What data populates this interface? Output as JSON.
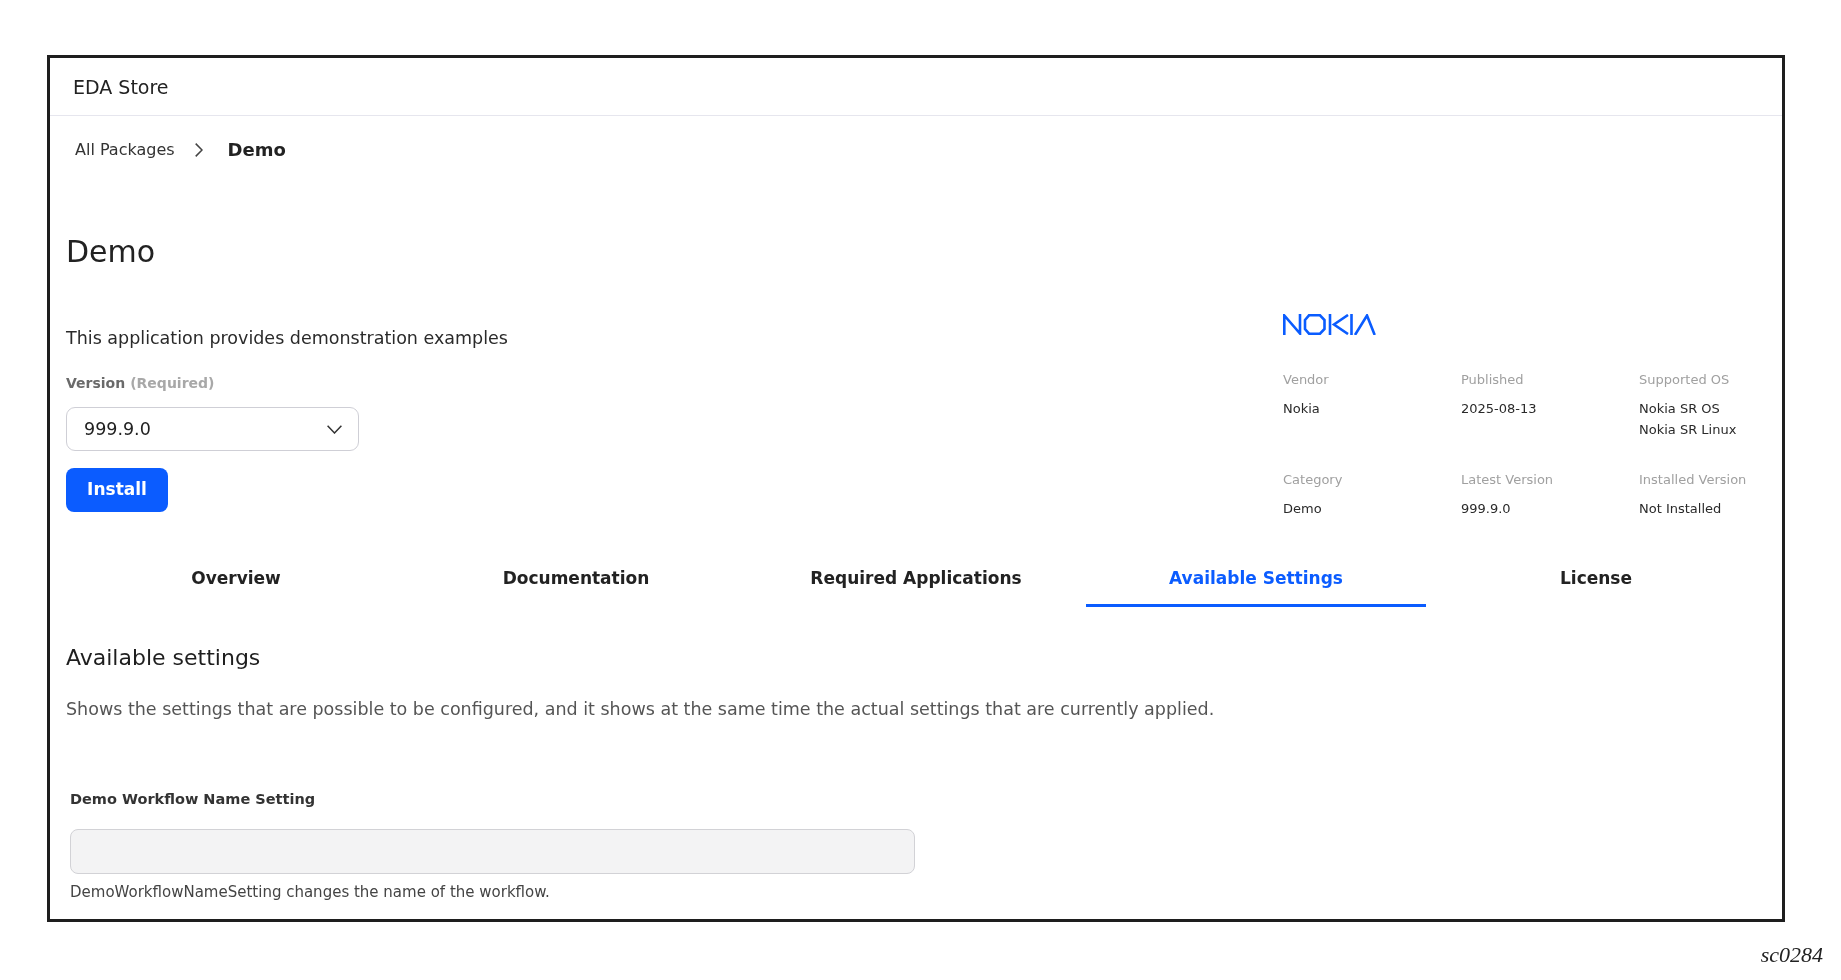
{
  "header": {
    "title": "EDA Store"
  },
  "breadcrumb": [
    {
      "label": "All Packages",
      "current": false
    },
    {
      "label": "Demo",
      "current": true
    }
  ],
  "package": {
    "title": "Demo",
    "description": "This application provides demonstration examples",
    "version_field": {
      "label": "Version",
      "required_note": "(Required)",
      "value": "999.9.0"
    },
    "install_button": "Install"
  },
  "details": [
    {
      "label": "Vendor",
      "values": [
        "Nokia"
      ]
    },
    {
      "label": "Published",
      "values": [
        "2025-08-13"
      ]
    },
    {
      "label": "Supported OS",
      "values": [
        "Nokia SR OS",
        "Nokia SR Linux"
      ]
    },
    {
      "label": "Category",
      "values": [
        "Demo"
      ]
    },
    {
      "label": "Latest Version",
      "values": [
        "999.9.0"
      ]
    },
    {
      "label": "Installed Version",
      "values": [
        "Not Installed"
      ]
    }
  ],
  "tabs": [
    {
      "label": "Overview",
      "selected": false
    },
    {
      "label": "Documentation",
      "selected": false
    },
    {
      "label": "Required Applications",
      "selected": false
    },
    {
      "label": "Available Settings",
      "selected": true
    },
    {
      "label": "License",
      "selected": false
    }
  ],
  "settings_section": {
    "title": "Available settings",
    "description": "Shows the settings that are possible to be configured, and it shows at the same time the actual settings that are currently applied.",
    "settings": [
      {
        "label": "Demo Workflow Name Setting",
        "help": "DemoWorkflowNameSetting changes the name of the workflow."
      }
    ]
  },
  "figure_id": "sc0284"
}
